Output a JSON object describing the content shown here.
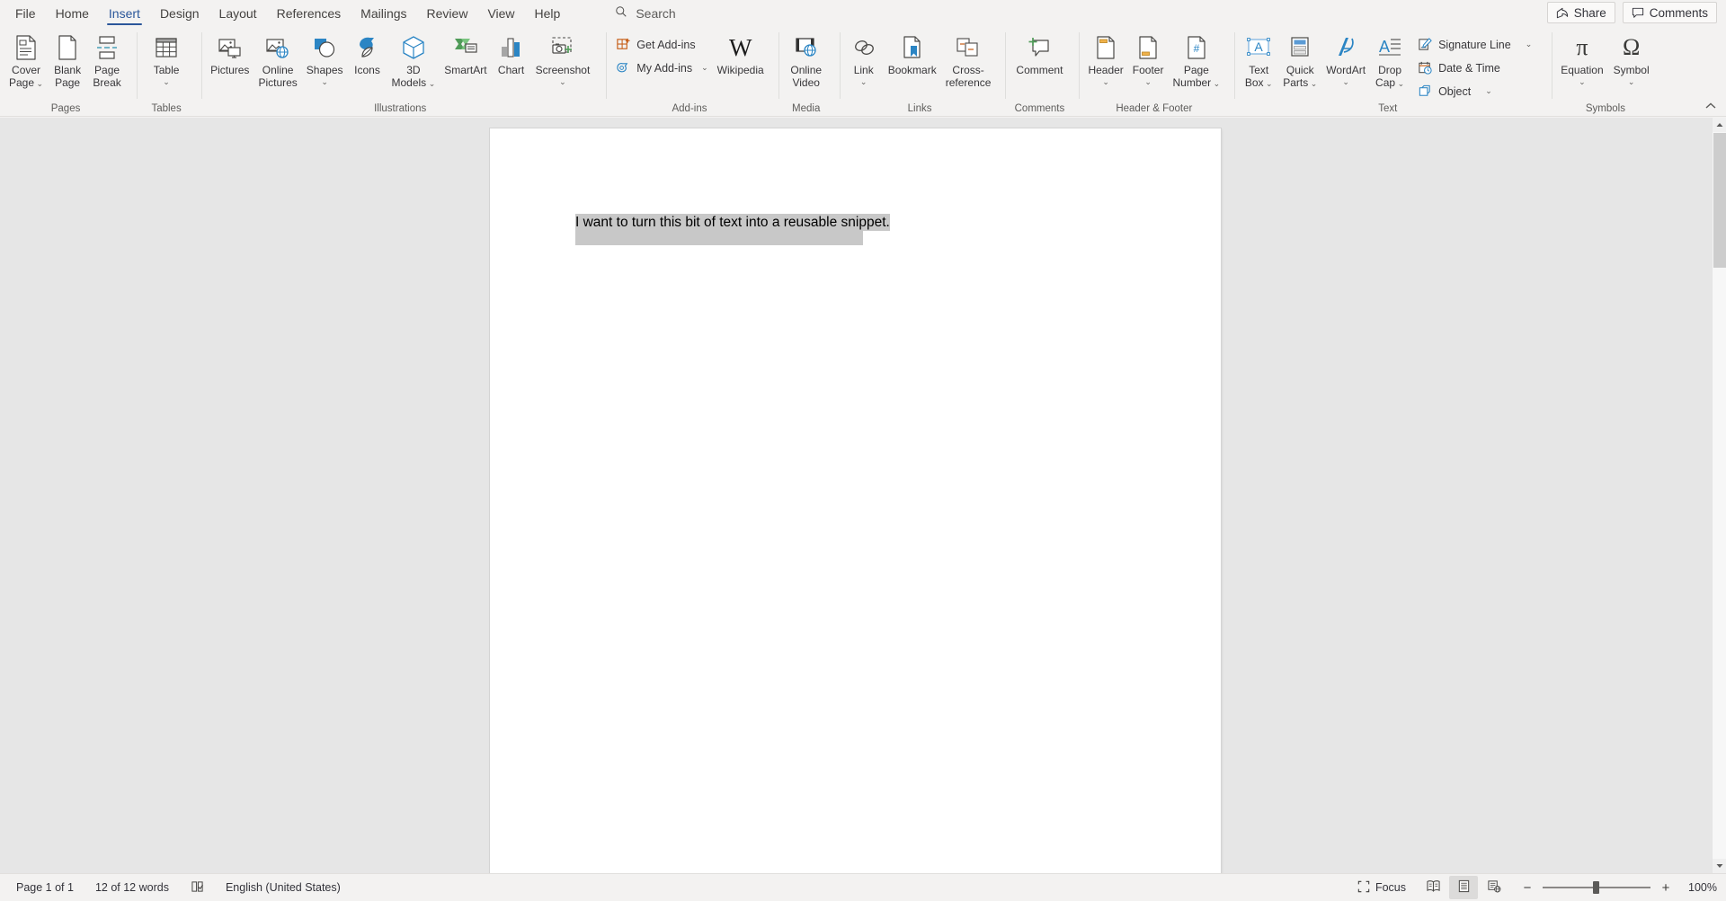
{
  "tabs": [
    {
      "label": "File",
      "active": false
    },
    {
      "label": "Home",
      "active": false
    },
    {
      "label": "Insert",
      "active": true
    },
    {
      "label": "Design",
      "active": false
    },
    {
      "label": "Layout",
      "active": false
    },
    {
      "label": "References",
      "active": false
    },
    {
      "label": "Mailings",
      "active": false
    },
    {
      "label": "Review",
      "active": false
    },
    {
      "label": "View",
      "active": false
    },
    {
      "label": "Help",
      "active": false
    }
  ],
  "search": {
    "label": "Search",
    "icon": "search-icon"
  },
  "titlebar_actions": [
    {
      "label": "Share",
      "icon": "share-icon"
    },
    {
      "label": "Comments",
      "icon": "comment-icon"
    }
  ],
  "ribbon": {
    "collapse_icon": "chevron-up-icon",
    "groups": [
      {
        "name": "Pages",
        "label": "Pages",
        "buttons": [
          {
            "caption": "Cover\nPage",
            "icon": "cover-page-icon",
            "has_chevron": true,
            "chevron_inline": true
          },
          {
            "caption": "Blank\nPage",
            "icon": "blank-page-icon",
            "has_chevron": false
          },
          {
            "caption": "Page\nBreak",
            "icon": "page-break-icon",
            "has_chevron": false
          }
        ]
      },
      {
        "name": "Tables",
        "label": "Tables",
        "buttons": [
          {
            "caption": "Table",
            "icon": "table-icon",
            "has_chevron": true,
            "chevron_inline": false
          }
        ]
      },
      {
        "name": "Illustrations",
        "label": "Illustrations",
        "buttons": [
          {
            "caption": "Pictures",
            "icon": "pictures-icon",
            "has_chevron": false
          },
          {
            "caption": "Online\nPictures",
            "icon": "online-pictures-icon",
            "has_chevron": false
          },
          {
            "caption": "Shapes",
            "icon": "shapes-icon",
            "has_chevron": true,
            "chevron_inline": false
          },
          {
            "caption": "Icons",
            "icon": "icons-icon",
            "has_chevron": false
          },
          {
            "caption": "3D\nModels",
            "icon": "3d-models-icon",
            "has_chevron": true,
            "chevron_inline": true
          },
          {
            "caption": "SmartArt",
            "icon": "smartart-icon",
            "has_chevron": false
          },
          {
            "caption": "Chart",
            "icon": "chart-icon",
            "has_chevron": false
          },
          {
            "caption": "Screenshot",
            "icon": "screenshot-icon",
            "has_chevron": true,
            "chevron_inline": false
          }
        ]
      },
      {
        "name": "Add-ins",
        "label": "Add-ins",
        "small_buttons": [
          {
            "caption": "Get Add-ins",
            "icon": "get-addins-icon",
            "has_chevron": false
          },
          {
            "caption": "My Add-ins",
            "icon": "my-addins-icon",
            "has_chevron": true
          }
        ],
        "buttons": [
          {
            "caption": "Wikipedia",
            "icon": "wikipedia-icon",
            "has_chevron": false
          }
        ]
      },
      {
        "name": "Media",
        "label": "Media",
        "buttons": [
          {
            "caption": "Online\nVideo",
            "icon": "online-video-icon",
            "has_chevron": false
          }
        ]
      },
      {
        "name": "Links",
        "label": "Links",
        "buttons": [
          {
            "caption": "Link",
            "icon": "link-icon",
            "has_chevron": true,
            "chevron_inline": false
          },
          {
            "caption": "Bookmark",
            "icon": "bookmark-icon",
            "has_chevron": false
          },
          {
            "caption": "Cross-\nreference",
            "icon": "cross-reference-icon",
            "has_chevron": false
          }
        ]
      },
      {
        "name": "Comments",
        "label": "Comments",
        "buttons": [
          {
            "caption": "Comment",
            "icon": "new-comment-icon",
            "has_chevron": false
          }
        ]
      },
      {
        "name": "Header & Footer",
        "label": "Header & Footer",
        "buttons": [
          {
            "caption": "Header",
            "icon": "header-icon",
            "has_chevron": true,
            "chevron_inline": false
          },
          {
            "caption": "Footer",
            "icon": "footer-icon",
            "has_chevron": true,
            "chevron_inline": false
          },
          {
            "caption": "Page\nNumber",
            "icon": "page-number-icon",
            "has_chevron": true,
            "chevron_inline": true
          }
        ]
      },
      {
        "name": "Text",
        "label": "Text",
        "buttons": [
          {
            "caption": "Text\nBox",
            "icon": "text-box-icon",
            "has_chevron": true,
            "chevron_inline": true
          },
          {
            "caption": "Quick\nParts",
            "icon": "quick-parts-icon",
            "has_chevron": true,
            "chevron_inline": true
          },
          {
            "caption": "WordArt",
            "icon": "wordart-icon",
            "has_chevron": true,
            "chevron_inline": false
          },
          {
            "caption": "Drop\nCap",
            "icon": "drop-cap-icon",
            "has_chevron": true,
            "chevron_inline": true
          }
        ],
        "small_buttons": [
          {
            "caption": "Signature Line",
            "icon": "signature-line-icon",
            "has_chevron": true
          },
          {
            "caption": "Date & Time",
            "icon": "date-time-icon",
            "has_chevron": false
          },
          {
            "caption": "Object",
            "icon": "object-icon",
            "has_chevron": true
          }
        ]
      },
      {
        "name": "Symbols",
        "label": "Symbols",
        "buttons": [
          {
            "caption": "Equation",
            "icon": "equation-icon",
            "has_chevron": true,
            "chevron_inline": false
          },
          {
            "caption": "Symbol",
            "icon": "symbol-icon",
            "has_chevron": true,
            "chevron_inline": false
          }
        ]
      }
    ]
  },
  "document": {
    "selected_text": "I want to turn this bit of text into a reusable snippet."
  },
  "statusbar": {
    "page": "Page 1 of 1",
    "words": "12 of 12 words",
    "proofing_icon": "proofing-icon",
    "language": "English (United States)",
    "focus": {
      "label": "Focus",
      "icon": "focus-icon"
    },
    "views": [
      {
        "name": "read-mode",
        "icon": "read-mode-icon",
        "active": false
      },
      {
        "name": "print-layout",
        "icon": "print-layout-icon",
        "active": true
      },
      {
        "name": "web-layout",
        "icon": "web-layout-icon",
        "active": false
      }
    ],
    "zoom_out_icon": "minus-icon",
    "zoom_in_icon": "plus-icon",
    "zoom_value": "100%"
  },
  "scrollbar": {
    "up_icon": "scroll-up-icon",
    "down_icon": "scroll-down-icon"
  },
  "colors": {
    "accent": "#2b579a",
    "ribbon_bg": "#f3f2f1",
    "canvas_bg": "#e6e6e6",
    "selection": "#c8c8c8"
  }
}
